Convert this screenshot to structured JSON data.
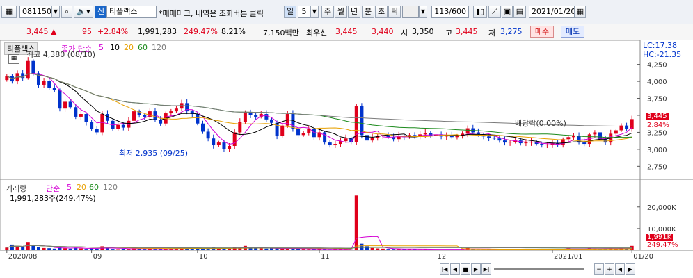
{
  "toolbar": {
    "code": "081150",
    "market_badge": "신",
    "stock_name": "티플랙스",
    "hint": "*매매마크, 내역은 조회버튼 클릭",
    "period_unit": "일",
    "period_value": "5",
    "periods": [
      "주",
      "월",
      "년",
      "분",
      "초",
      "틱"
    ],
    "counter": "113/600",
    "date": "2021/01/20"
  },
  "quote": {
    "price": "3,445",
    "change_arrow": "▲",
    "change": "95",
    "change_pct": "+2.84%",
    "volume": "1,991,283",
    "vol_ratio": "249.47%",
    "turnover": "8.21%",
    "amount": "7,150백만",
    "best_label": "최우선",
    "ask": "3,445",
    "bid": "3,440",
    "open_label": "시",
    "open": "3,350",
    "high_label": "고",
    "high": "3,445",
    "low_label": "저",
    "low": "3,275",
    "buy_button": "매수",
    "sell_button": "매도"
  },
  "price_legend": {
    "name": "티플랙스",
    "ma_label": "종가 단순",
    "ma_periods": [
      "5",
      "10",
      "20",
      "60",
      "120"
    ],
    "ma_colors": [
      "#d400d4",
      "#000000",
      "#e8a000",
      "#1c8a1c",
      "#7a7a7a"
    ],
    "lc_label": "LC:17.38",
    "hc_label": "HC:-21.35",
    "last_price_tag": "3,445",
    "last_pct_tag": "2.84%",
    "max_annotation": "최고 4,380 (08/10)",
    "min_annotation": "최저 2,935 (09/25)",
    "dividend_annotation": "배당락(0.00%)"
  },
  "volume_legend": {
    "title": "거래량",
    "ma_label": "단순",
    "ma_periods": [
      "5",
      "20",
      "60",
      "120"
    ],
    "value_text": "1,991,283주(249.47%)",
    "last_tag": "1,991K",
    "last_pct_tag": "249.47%"
  },
  "chart_data": [
    {
      "type": "candlestick",
      "title": "",
      "ylim": [
        2600,
        4420
      ],
      "y_ticks": [
        "4,250",
        "4,000",
        "3,750",
        "3,500",
        "3,250",
        "3,000",
        "2,750"
      ],
      "x_ticks": [
        "2020/08",
        "09",
        "10",
        "11",
        "12",
        "2021/01",
        "01/20"
      ],
      "closes": [
        4080,
        4000,
        4120,
        4050,
        4300,
        4120,
        3950,
        4010,
        3900,
        3870,
        3600,
        3700,
        3620,
        3480,
        3520,
        3400,
        3300,
        3250,
        3520,
        3420,
        3300,
        3360,
        3320,
        3420,
        3560,
        3500,
        3480,
        3560,
        3430,
        3380,
        3530,
        3560,
        3600,
        3680,
        3560,
        3520,
        3380,
        3260,
        3160,
        3060,
        3100,
        3000,
        3050,
        3250,
        3400,
        3550,
        3500,
        3480,
        3520,
        3440,
        3390,
        3200,
        3350,
        3520,
        3300,
        3210,
        3240,
        3300,
        3180,
        3250,
        3100,
        3060,
        3080,
        3120,
        3160,
        3110,
        3640,
        3210,
        3130,
        3170,
        3200,
        3210,
        3180,
        3150,
        3200,
        3180,
        3210,
        3190,
        3220,
        3240,
        3200,
        3220,
        3190,
        3200,
        3180,
        3200,
        3230,
        3310,
        3250,
        3220,
        3190,
        3170,
        3160,
        3130,
        3100,
        3110,
        3130,
        3090,
        3100,
        3110,
        3080,
        3060,
        3070,
        3090,
        3060,
        3150,
        3180,
        3200,
        3100,
        3080,
        3220,
        3250,
        3150,
        3100,
        3230,
        3280,
        3350,
        3300,
        3445
      ],
      "ma_lines": [
        "5",
        "10",
        "20",
        "60",
        "120"
      ]
    },
    {
      "type": "bar",
      "title": "",
      "y_ticks": [
        "20,000K",
        "10,000K"
      ],
      "ylim": [
        0,
        27000
      ],
      "volumes_k": [
        1200,
        2600,
        1800,
        1500,
        3800,
        2500,
        1300,
        1000,
        900,
        700,
        1600,
        900,
        700,
        1200,
        800,
        600,
        800,
        700,
        1800,
        900,
        600,
        500,
        700,
        600,
        900,
        800,
        600,
        700,
        600,
        500,
        800,
        700,
        900,
        1100,
        900,
        800,
        1000,
        900,
        700,
        1300,
        800,
        900,
        700,
        1600,
        1200,
        2000,
        1200,
        900,
        800,
        700,
        900,
        800,
        700,
        900,
        700,
        700,
        600,
        500,
        600,
        800,
        500,
        400,
        500,
        600,
        500,
        400,
        25300,
        3000,
        1800,
        1000,
        800,
        700,
        600,
        600,
        500,
        500,
        600,
        500,
        400,
        500,
        400,
        500,
        400,
        400,
        500,
        500,
        600,
        1000,
        500,
        400,
        400,
        500,
        400,
        400,
        500,
        400,
        400,
        400,
        500,
        400,
        400,
        500,
        400,
        400,
        500,
        600,
        800,
        500,
        400,
        500,
        900,
        700,
        600,
        500,
        900,
        600,
        1100,
        800,
        1991
      ]
    }
  ]
}
